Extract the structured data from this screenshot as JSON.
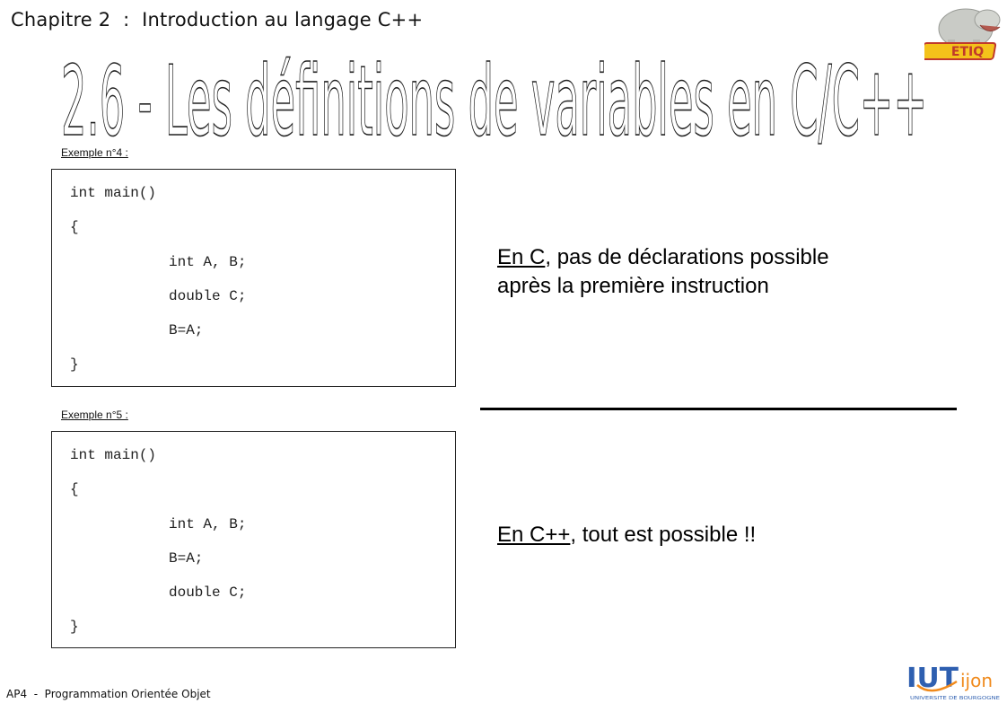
{
  "header": {
    "chapter_title": "Chapitre 2  :  Introduction au langage C++",
    "section_title": "2.6  -  Les définitions de variables en C/C++"
  },
  "logos": {
    "top_right": {
      "icon": "hippo-mascot-logo",
      "text": "ETIQ",
      "colors": {
        "text_fill": "#f4c21a",
        "text_outline": "#c0392b",
        "body": "#c9cbc6"
      }
    },
    "bottom_right": {
      "icon": "iut-dijon-logo",
      "main": "IUT",
      "accent": "ijon",
      "subtitle": "UNIVERSITE DE BOURGOGNE",
      "colors": {
        "blue": "#2e5fb0",
        "orange": "#f08a1c"
      }
    }
  },
  "examples": [
    {
      "label": "Exemple n°4 :",
      "code": [
        "int main()",
        "{",
        "int A, B;",
        "double C;",
        "B=A;",
        "}"
      ]
    },
    {
      "label": "Exemple n°5 :",
      "code": [
        "int main()",
        "{",
        "int A, B;",
        "B=A;",
        "double C;",
        "}"
      ]
    }
  ],
  "notes": {
    "c": {
      "emphasis": "En C",
      "rest_line1": ", pas de déclarations possible",
      "line2": "après la première instruction"
    },
    "cpp": {
      "emphasis": "En C++",
      "rest": ", tout est possible !!"
    }
  },
  "footer": {
    "course": "AP4  -  Programmation Orientée Objet"
  }
}
